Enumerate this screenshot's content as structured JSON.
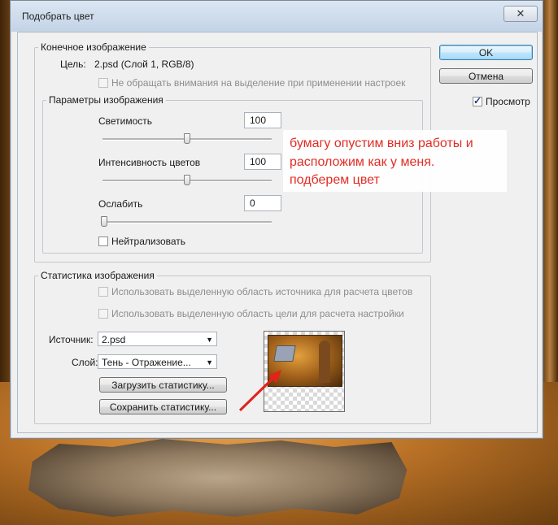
{
  "dialog": {
    "title": "Подобрать цвет",
    "close_glyph": "✕"
  },
  "target_group": {
    "legend": "Конечное изображение",
    "target_label": "Цель:",
    "target_value": "2.psd (Слой 1, RGB/8)",
    "ignore_selection_label": "Не обращать внимания на выделение при применении настроек",
    "ignore_selection_checked": false,
    "ignore_selection_enabled": false
  },
  "image_options": {
    "legend": "Параметры изображения",
    "luminance_label": "Светимость",
    "luminance_value": "100",
    "luminance_level": 0.5,
    "intensity_label": "Интенсивность цветов",
    "intensity_value": "100",
    "intensity_level": 0.5,
    "fade_label": "Ослабить",
    "fade_value": "0",
    "fade_level": 0,
    "neutralize_label": "Нейтрализовать",
    "neutralize_checked": false
  },
  "statistics": {
    "legend": "Статистика изображения",
    "use_source_selection_label": "Использовать выделенную область источника для расчета цветов",
    "use_target_selection_label": "Использовать выделенную область цели для расчета настройки",
    "source_label": "Источник:",
    "source_value": "2.psd",
    "layer_label": "Слой:",
    "layer_value": "Тень - Отражение...",
    "load_button": "Загрузить статистику...",
    "save_button": "Сохранить статистику..."
  },
  "buttons": {
    "ok": "OK",
    "cancel": "Отмена",
    "preview_label": "Просмотр",
    "preview_checked": true
  },
  "annotation": {
    "line1": "бумагу опустим вниз работы и",
    "line2": "расположим как у меня.",
    "line3": "подберем цвет",
    "color": "#e2231a"
  },
  "icons": {
    "dropdown": "▼",
    "checkmark": "✓"
  }
}
